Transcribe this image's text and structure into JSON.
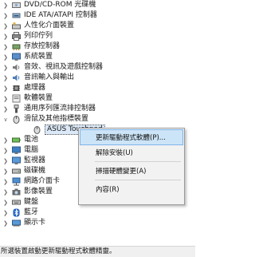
{
  "tree": {
    "items": [
      {
        "label": "DVD/CD-ROM 光碟機",
        "icon": "dvd-drive-icon"
      },
      {
        "label": "IDE ATA/ATAPI 控制器",
        "icon": "ide-controller-icon"
      },
      {
        "label": "人性化介面裝置",
        "icon": "hid-icon"
      },
      {
        "label": "列印佇列",
        "icon": "print-queue-icon"
      },
      {
        "label": "存放控制器",
        "icon": "storage-controller-icon"
      },
      {
        "label": "系統裝置",
        "icon": "system-devices-icon"
      },
      {
        "label": "音效、視訊及遊戲控制器",
        "icon": "sound-icon"
      },
      {
        "label": "音訊輸入與輸出",
        "icon": "audio-io-icon"
      },
      {
        "label": "處理器",
        "icon": "processor-icon"
      },
      {
        "label": "軟體裝置",
        "icon": "software-device-icon"
      },
      {
        "label": "通用序列匯流排控制器",
        "icon": "usb-icon"
      },
      {
        "label": "滑鼠及其他指標裝置",
        "icon": "mouse-icon",
        "expanded": true
      },
      {
        "label": "ASUS Touchpad",
        "icon": "touchpad-icon",
        "child": true,
        "selected": true
      },
      {
        "label": "電池",
        "icon": "battery-icon"
      },
      {
        "label": "電腦",
        "icon": "computer-icon"
      },
      {
        "label": "監視器",
        "icon": "monitor-icon"
      },
      {
        "label": "磁碟機",
        "icon": "disk-drive-icon"
      },
      {
        "label": "網路介面卡",
        "icon": "network-adapter-icon"
      },
      {
        "label": "影像裝置",
        "icon": "imaging-device-icon"
      },
      {
        "label": "鍵盤",
        "icon": "keyboard-icon"
      },
      {
        "label": "藍牙",
        "icon": "bluetooth-icon"
      },
      {
        "label": "顯示卡",
        "icon": "display-adapter-icon"
      }
    ]
  },
  "context_menu": {
    "update_driver": "更新驅動程式軟體(P)...",
    "uninstall": "解除安裝(U)",
    "scan_hardware": "掃描硬體變更(A)",
    "properties": "內容(R)"
  },
  "status_bar": {
    "text": "所選裝置啟動更新驅動程式軟體精靈。"
  },
  "colors": {
    "menu_highlight": "#cce4f7",
    "selection": "#dbe8f7"
  }
}
